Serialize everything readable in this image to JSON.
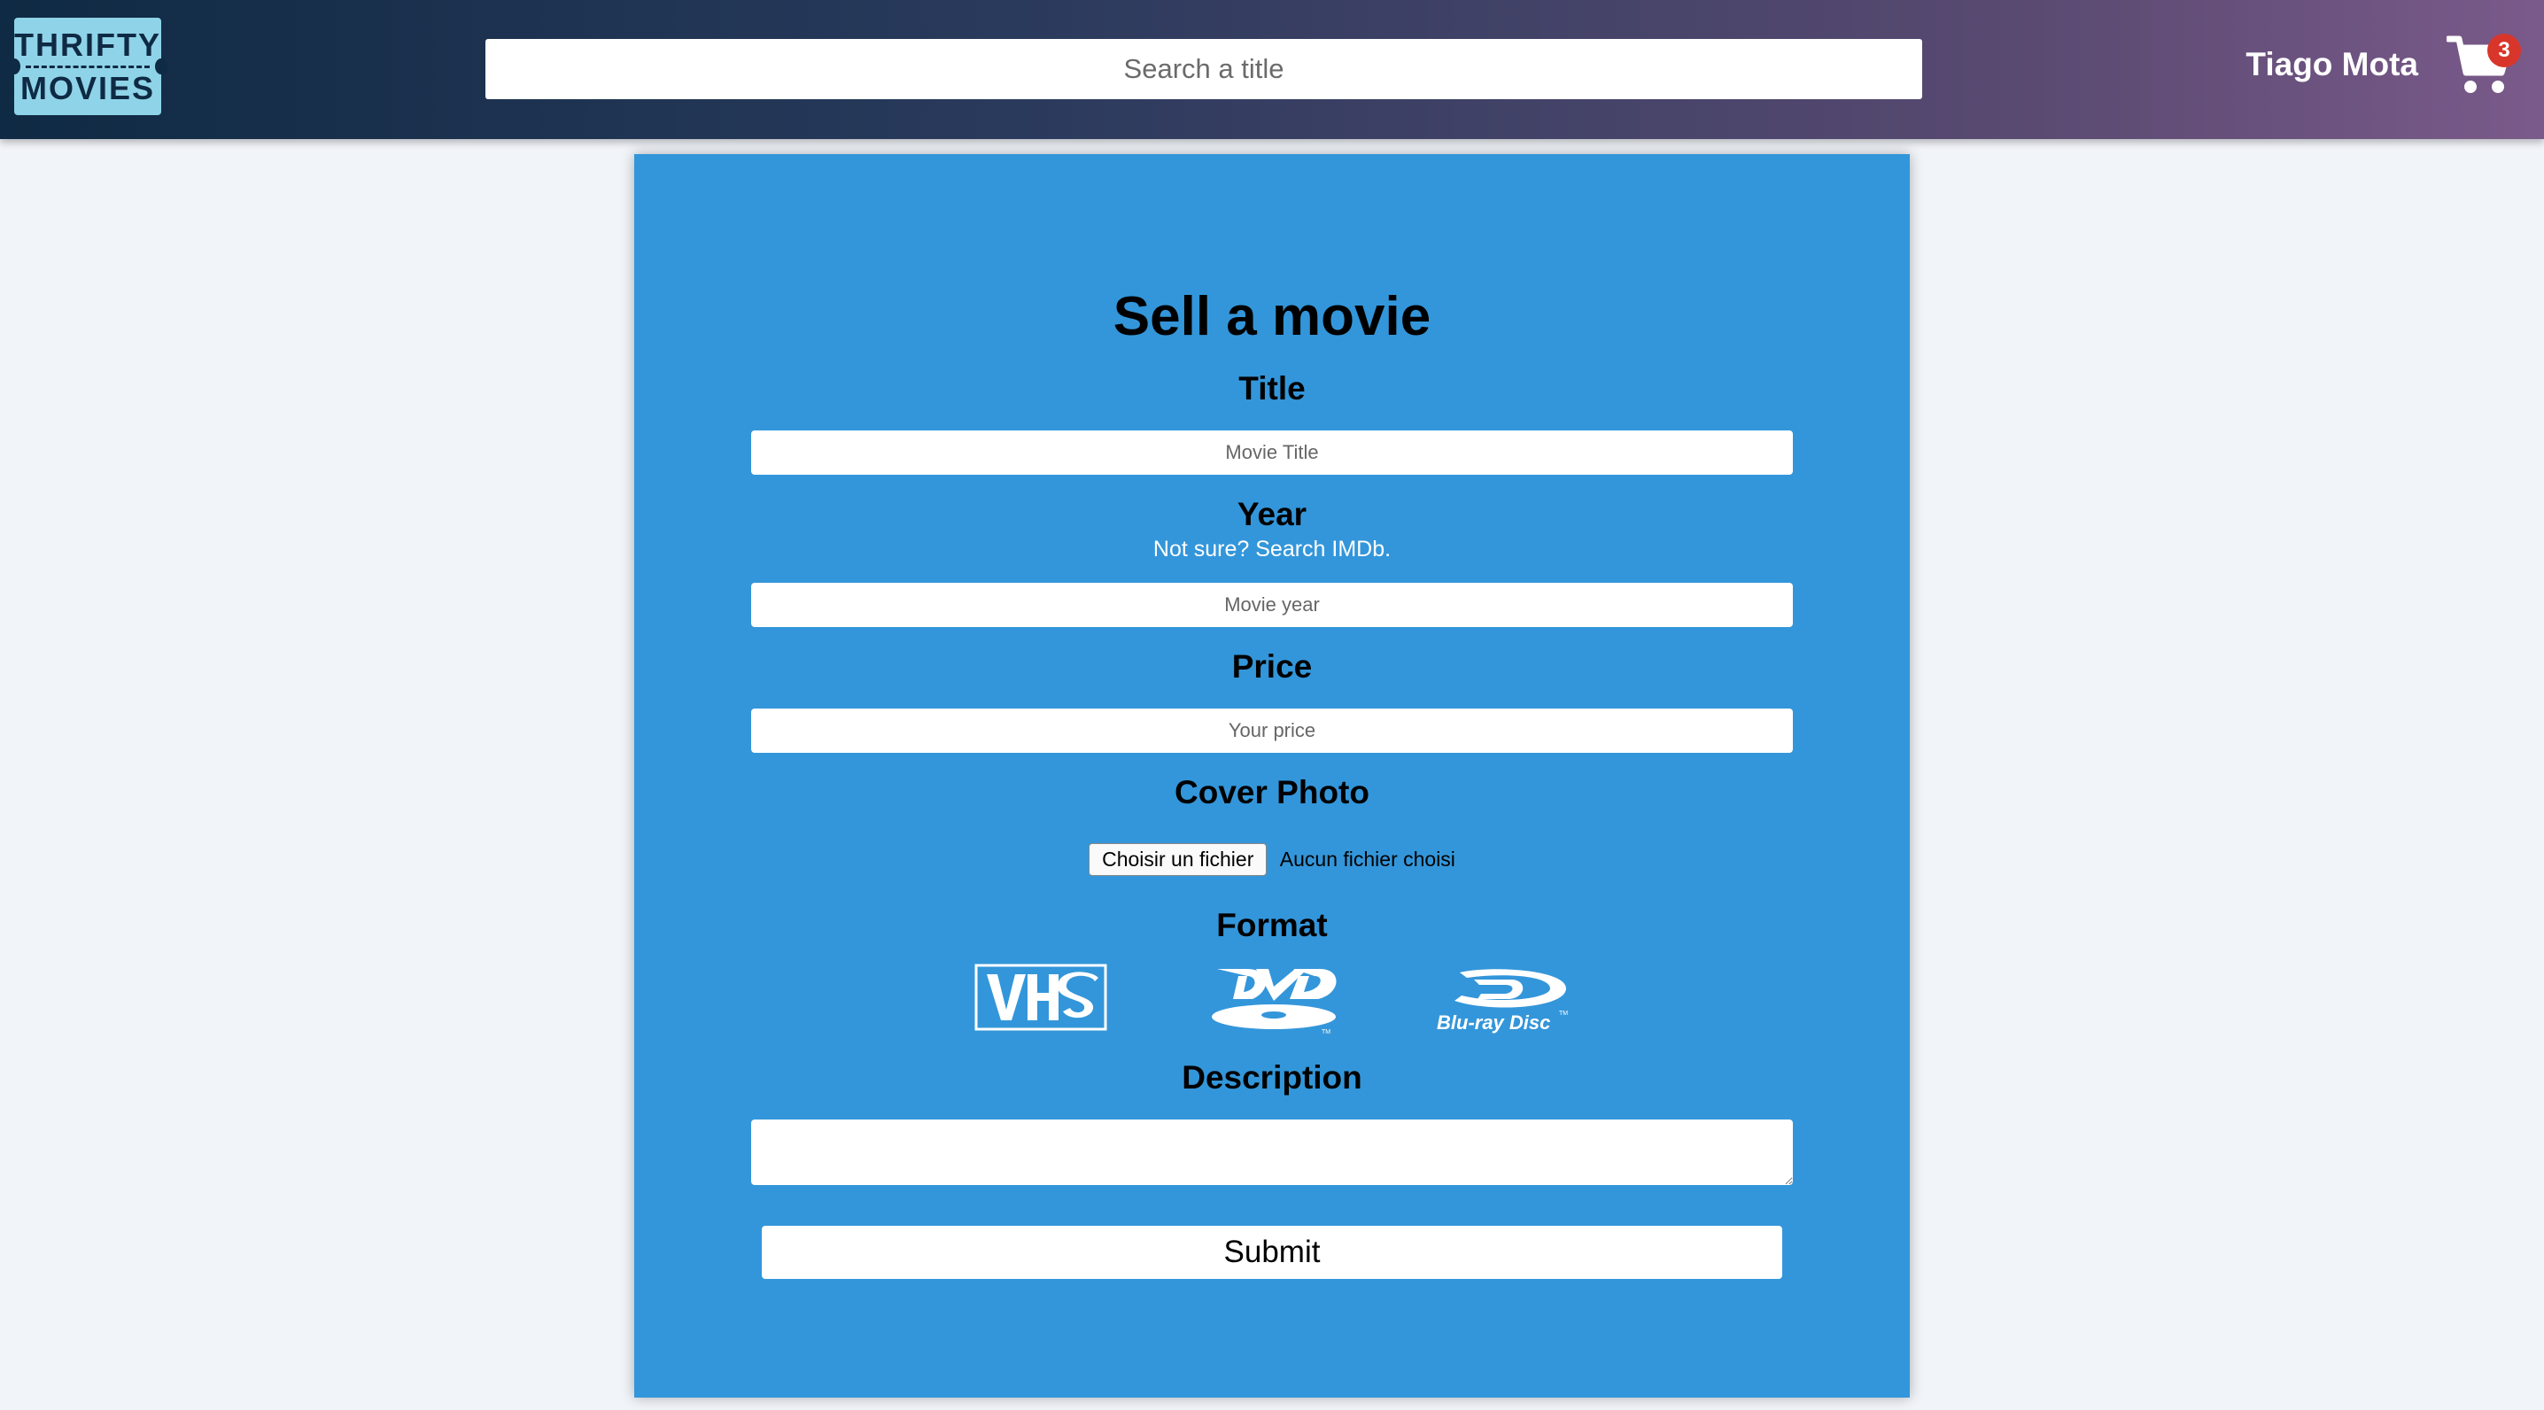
{
  "header": {
    "logo_line1": "THRIFTY",
    "logo_line2": "MOVIES",
    "search_placeholder": "Search a title",
    "username": "Tiago Mota",
    "cart_icon": "shopping-cart-icon",
    "cart_count": "3"
  },
  "form": {
    "heading": "Sell a movie",
    "title_label": "Title",
    "title_placeholder": "Movie Title",
    "year_label": "Year",
    "year_hint": "Not sure? Search IMDb.",
    "year_placeholder": "Movie year",
    "price_label": "Price",
    "price_placeholder": "Your price",
    "cover_label": "Cover Photo",
    "file_button": "Choisir un fichier",
    "file_status": "Aucun fichier choisi",
    "format_label": "Format",
    "formats": [
      {
        "name": "VHS",
        "icon": "vhs-logo-icon"
      },
      {
        "name": "DVD",
        "icon": "dvd-logo-icon"
      },
      {
        "name": "Blu-ray Disc",
        "icon": "bluray-logo-icon"
      }
    ],
    "description_label": "Description",
    "submit_label": "Submit"
  },
  "colors": {
    "panel": "#3396da",
    "background": "#f1f4f9",
    "badge": "#d9362b"
  }
}
